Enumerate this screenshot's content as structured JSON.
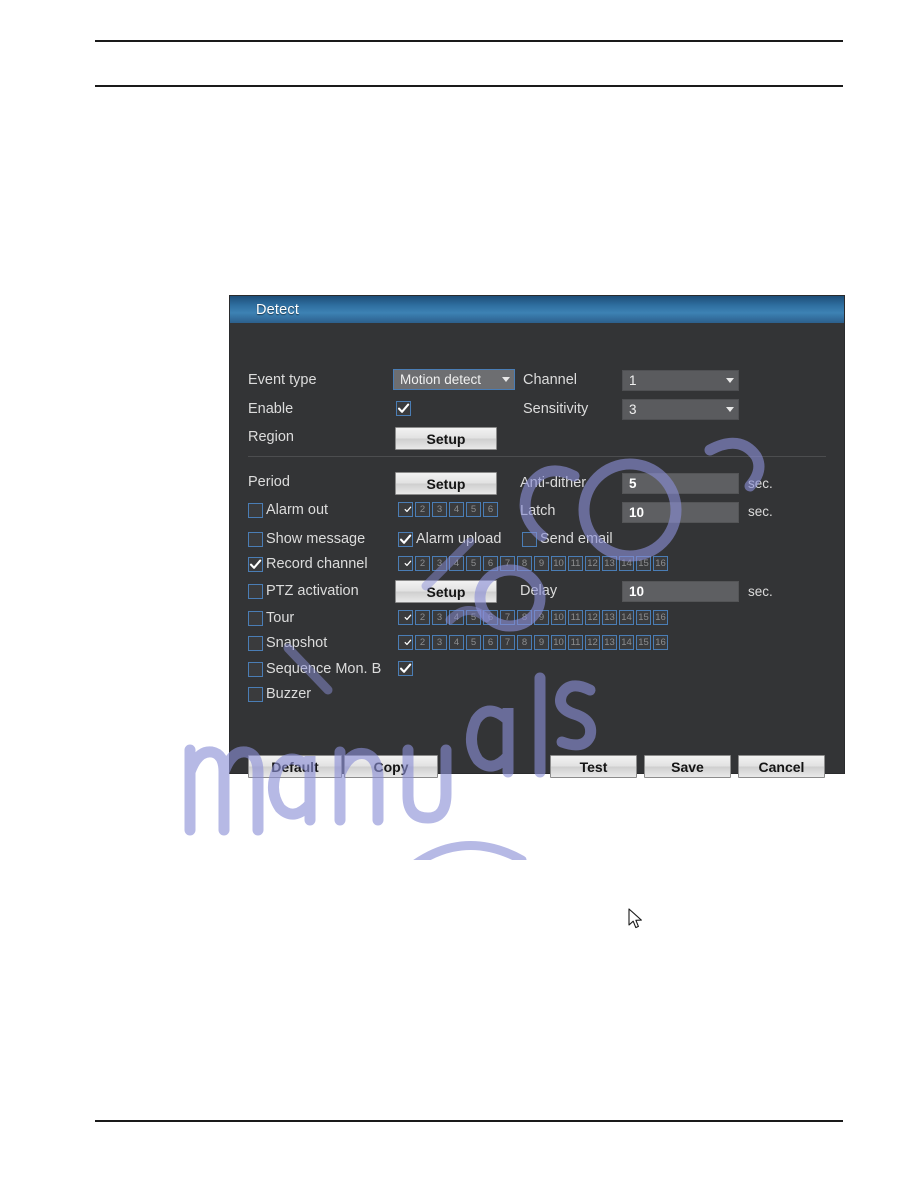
{
  "page": {
    "rules": [
      "top-rule",
      "second-rule",
      "footer-rule"
    ],
    "watermark_text": "manualslib.com"
  },
  "dialog": {
    "title": "Detect",
    "top_section": {
      "event_type": {
        "label": "Event type",
        "value": "Motion detect"
      },
      "channel": {
        "label": "Channel",
        "value": "1"
      },
      "enable": {
        "label": "Enable",
        "checked": true
      },
      "sensitivity": {
        "label": "Sensitivity",
        "value": "3"
      },
      "region": {
        "label": "Region",
        "button": "Setup"
      }
    },
    "main_section": {
      "period": {
        "label": "Period",
        "button": "Setup"
      },
      "anti_dither": {
        "label": "Anti-dither",
        "value": "5",
        "unit": "sec."
      },
      "alarm_out": {
        "label": "Alarm out",
        "checked": false,
        "channels": [
          "1",
          "2",
          "3",
          "4",
          "5",
          "6"
        ],
        "channels_on": [
          true,
          false,
          false,
          false,
          false,
          false
        ]
      },
      "latch": {
        "label": "Latch",
        "value": "10",
        "unit": "sec."
      },
      "show_message": {
        "label": "Show message",
        "checked": false
      },
      "alarm_upload": {
        "label": "Alarm upload",
        "checked": true
      },
      "send_email": {
        "label": "Send email",
        "checked": false
      },
      "record_channel": {
        "label": "Record channel",
        "checked": true,
        "channels": [
          "1",
          "2",
          "3",
          "4",
          "5",
          "6",
          "7",
          "8",
          "9",
          "10",
          "11",
          "12",
          "13",
          "14",
          "15",
          "16"
        ],
        "channels_on": [
          true,
          false,
          false,
          false,
          false,
          false,
          false,
          false,
          false,
          false,
          false,
          false,
          false,
          false,
          false,
          false
        ]
      },
      "ptz_activation": {
        "label": "PTZ activation",
        "checked": false,
        "button": "Setup"
      },
      "delay": {
        "label": "Delay",
        "value": "10",
        "unit": "sec."
      },
      "tour": {
        "label": "Tour",
        "checked": false,
        "channels": [
          "1",
          "2",
          "3",
          "4",
          "5",
          "6",
          "7",
          "8",
          "9",
          "10",
          "11",
          "12",
          "13",
          "14",
          "15",
          "16"
        ],
        "channels_on": [
          true,
          false,
          false,
          false,
          false,
          false,
          false,
          false,
          false,
          false,
          false,
          false,
          false,
          false,
          false,
          false
        ]
      },
      "snapshot": {
        "label": "Snapshot",
        "checked": false,
        "channels": [
          "1",
          "2",
          "3",
          "4",
          "5",
          "6",
          "7",
          "8",
          "9",
          "10",
          "11",
          "12",
          "13",
          "14",
          "15",
          "16"
        ],
        "channels_on": [
          true,
          false,
          false,
          false,
          false,
          false,
          false,
          false,
          false,
          false,
          false,
          false,
          false,
          false,
          false,
          false
        ]
      },
      "sequence_mon_b": {
        "label": "Sequence Mon. B",
        "checked": false,
        "extra_checked": true
      },
      "buzzer": {
        "label": "Buzzer",
        "checked": false
      }
    },
    "footer": {
      "default": "Default",
      "copy": "Copy",
      "test": "Test",
      "save": "Save",
      "cancel": "Cancel"
    }
  },
  "colors": {
    "dialog_bg": "#333436",
    "titlebar_blue": "#2f6fa0",
    "checkbox_border": "#4a7db5",
    "input_bg": "#5e5f62",
    "watermark": "#8b8fd6"
  }
}
